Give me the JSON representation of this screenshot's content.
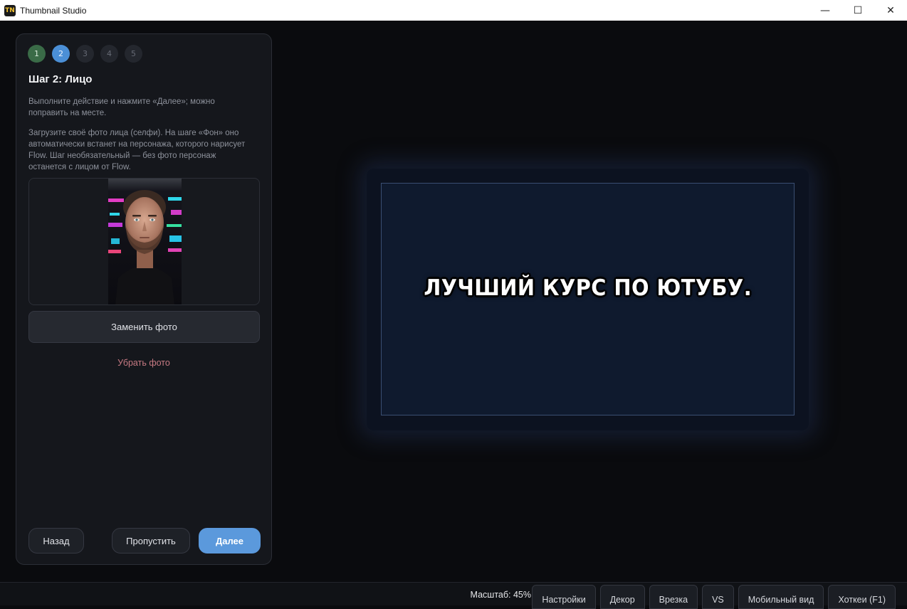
{
  "window": {
    "icon_text": "TN",
    "title": "Thumbnail Studio",
    "minimize": "—",
    "maximize": "☐",
    "close": "✕"
  },
  "wizard": {
    "steps": [
      {
        "number": "1",
        "state": "done"
      },
      {
        "number": "2",
        "state": "active"
      },
      {
        "number": "3",
        "state": "pending"
      },
      {
        "number": "4",
        "state": "pending"
      },
      {
        "number": "5",
        "state": "pending"
      }
    ],
    "title": "Шаг 2: Лицо",
    "hint": "Выполните действие и нажмите «Далее»; можно поправить на месте.",
    "description": "Загрузите своё фото лица (селфи). На шаге «Фон» оно автоматически встанет на персонажа, которого нарисует Flow. Шаг необязательный — без фото персонаж останется с лицом от Flow.",
    "replace_photo_label": "Заменить фото",
    "remove_photo_label": "Убрать фото",
    "back_label": "Назад",
    "skip_label": "Пропустить",
    "next_label": "Далее"
  },
  "preview": {
    "headline": "ЛУЧШИЙ КУРС ПО ЮТУБУ."
  },
  "statusbar": {
    "zoom_label": "Масштаб: 45%",
    "tabs": [
      "Настройки",
      "Декор",
      "Врезка",
      "VS",
      "Мобильный вид",
      "Хоткеи (F1)"
    ]
  }
}
